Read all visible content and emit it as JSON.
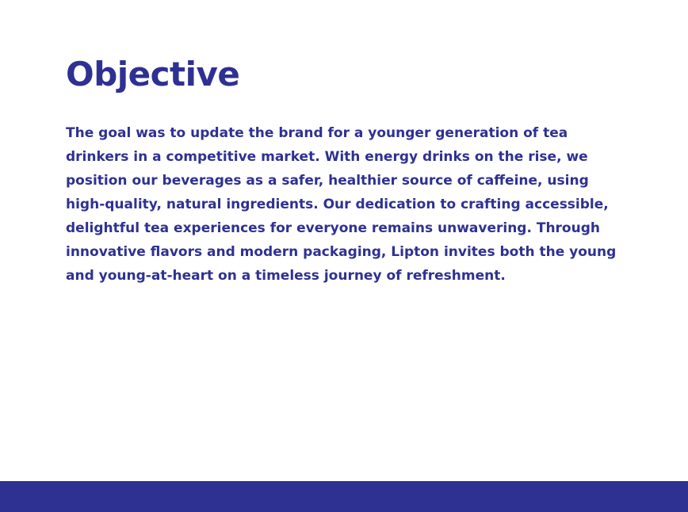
{
  "section": {
    "title": "Objective",
    "body": "The goal was to update the brand for a younger generation of tea drinkers in a competitive market. With energy drinks on the rise, we position our beverages as a safer, healthier source of caffeine, using high-quality, natural ingredients. Our dedication to crafting accessible, delightful tea experiences for everyone remains unwavering. Through innovative flavors and modern packaging, Lipton invites both the young and young-at-heart on a timeless journey of refreshment."
  },
  "colors": {
    "brand": "#2e3192",
    "background": "#ffffff"
  }
}
